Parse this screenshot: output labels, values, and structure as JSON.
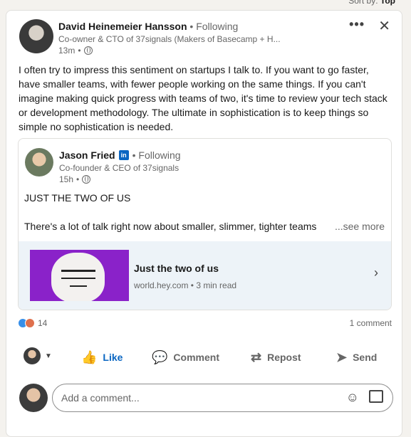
{
  "sort": {
    "label": "Sort by:",
    "value": "Top"
  },
  "post": {
    "author_name": "David Heinemeier Hansson",
    "follow_status": "Following",
    "headline": "Co-owner & CTO of 37signals (Makers of Basecamp + H...",
    "time": "13m",
    "text": "I often try to impress this sentiment on startups I talk to. If you want to go faster, have smaller teams, with fewer people working on the same things. If you can't imagine making quick progress with teams of two, it's time to review your tech stack or development methodology. The ultimate in sophistication is to keep things so simple no sophistication is needed."
  },
  "quote": {
    "author_name": "Jason Fried",
    "badge": "in",
    "follow_status": "Following",
    "headline": "Co-founder & CEO of 37signals",
    "time": "15h",
    "title": "JUST THE TWO OF US",
    "excerpt": "There's a lot of talk right now about smaller, slimmer, tighter teams",
    "see_more": "...see more",
    "link": {
      "title": "Just the two of us",
      "meta": "world.hey.com • 3 min read"
    }
  },
  "reactions": {
    "count": "14",
    "comments": "1 comment"
  },
  "actions": {
    "like": "Like",
    "comment": "Comment",
    "repost": "Repost",
    "send": "Send"
  },
  "composer": {
    "placeholder": "Add a comment..."
  }
}
